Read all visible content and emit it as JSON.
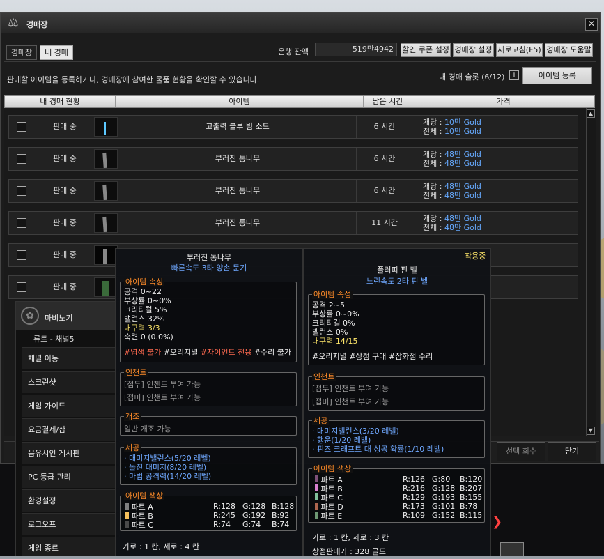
{
  "window": {
    "title": "경매장",
    "close": "✕"
  },
  "tabs": [
    {
      "label": "경매장",
      "active": false
    },
    {
      "label": "내 경매",
      "active": true
    }
  ],
  "bank": {
    "label": "은행 잔액",
    "value": "519만4942"
  },
  "header_buttons": [
    "할인 쿠폰 설정",
    "경매장 설정",
    "새로고침(F5)",
    "경매장 도움말"
  ],
  "info_text": "판매할 아이템을 등록하거나, 경매장에 참여한 물품 현황을 확인할 수 있습니다.",
  "slots": {
    "label": "내 경매 슬롯 (6/12)",
    "plus": "+",
    "register": "아이템 등록"
  },
  "columns": [
    "내 경매 현황",
    "아이템",
    "남은 시간",
    "가격"
  ],
  "rows": [
    {
      "status": "판매 중",
      "item": "고출력 블루 빔 소드",
      "time": "6 시간",
      "unit_label": "개당 : ",
      "unit": "10만 Gold",
      "total_label": "전체 : ",
      "total": "10만 Gold"
    },
    {
      "status": "판매 중",
      "item": "부러진 통나무",
      "time": "6 시간",
      "unit_label": "개당 : ",
      "unit": "48만 Gold",
      "total_label": "전체 : ",
      "total": "48만 Gold"
    },
    {
      "status": "판매 중",
      "item": "부러진 통나무",
      "time": "6 시간",
      "unit_label": "개당 : ",
      "unit": "48만 Gold",
      "total_label": "전체 : ",
      "total": "48만 Gold"
    },
    {
      "status": "판매 중",
      "item": "부러진 통나무",
      "time": "11 시간",
      "unit_label": "개당 : ",
      "unit": "48만 Gold",
      "total_label": "전체 : ",
      "total": "48만 Gold"
    },
    {
      "status": "판매 중"
    },
    {
      "status": "판매 중"
    }
  ],
  "bottom": {
    "select_count": "선택 회수",
    "close": "닫기"
  },
  "menu": {
    "logo": "마비노기",
    "channel": "류트 - 채널5",
    "items": [
      "채널 이동",
      "스크린샷",
      "게임 가이드",
      "요금결제/샵",
      "음유시인 게시판",
      "PC 등급 관리",
      "환경설정",
      "로그오프",
      "게임 종료"
    ]
  },
  "tooltip_left": {
    "name": "부러진 통나무",
    "sub": "빠른속도 3타 양손 둔기",
    "attr_title": "아이템 속성",
    "attrs": [
      "공격 0~22",
      "부상률 0~0%",
      "크리티컬 5%",
      "밸런스 32%"
    ],
    "durability": "내구력 3/3",
    "proficiency": "숙련 0 (0.0%)",
    "tags": [
      "#염색 불가",
      "#오리지널",
      "#자이언트 전용",
      "#수리 불가"
    ],
    "enchant_title": "인챈트",
    "enchant": [
      "[접두] 인챈트 부여 가능",
      "[접미] 인챈트 부여 가능"
    ],
    "reform_title": "개조",
    "reform": "일반 개조 가능",
    "craft_title": "세공",
    "craft": [
      "· 대미지밸런스(5/20 레벨)",
      "· 돌진 대미지(8/20 레벨)",
      "· 마법 공격력(14/20 레벨)"
    ],
    "color_title": "아이템 색상",
    "colors": [
      {
        "name": "파트 A",
        "r": "R:128",
        "g": "G:128",
        "b": "B:128",
        "hex": "#808080"
      },
      {
        "name": "파트 B",
        "r": "R:245",
        "g": "G:192",
        "b": "B:92",
        "hex": "#f5c05c"
      },
      {
        "name": "파트 C",
        "r": "R:74",
        "g": "G:74",
        "b": "B:74",
        "hex": "#4a4a4a"
      }
    ],
    "size": "가로 : 1 칸, 세로 : 4 칸"
  },
  "tooltip_right": {
    "equipped": "착용중",
    "name": "플러피 핀 벨",
    "sub": "느린속도 2타 핀 벨",
    "attr_title": "아이템 속성",
    "attrs": [
      "공격 2~5",
      "부상률 0~0%",
      "크리티컬 0%",
      "밸런스 0%"
    ],
    "durability": "내구력 14/15",
    "tags": [
      "#오리지널",
      "#상점 구매",
      "#잡화점 수리"
    ],
    "enchant_title": "인챈트",
    "enchant": [
      "[접두] 인챈트 부여 가능",
      "[접미] 인챈트 부여 가능"
    ],
    "craft_title": "세공",
    "craft": [
      "· 대미지밸런스(3/20 레벨)",
      "· 행운(1/20 레벨)",
      "· 핀즈 크래프트 대 성공 확률(1/10 레벨)"
    ],
    "color_title": "아이템 색상",
    "colors": [
      {
        "name": "파트 A",
        "r": "R:126",
        "g": "G:80",
        "b": "B:120",
        "hex": "#7e5078"
      },
      {
        "name": "파트 B",
        "r": "R:216",
        "g": "G:128",
        "b": "B:207",
        "hex": "#d880cf"
      },
      {
        "name": "파트 C",
        "r": "R:129",
        "g": "G:193",
        "b": "B:155",
        "hex": "#81c19b"
      },
      {
        "name": "파트 D",
        "r": "R:173",
        "g": "G:101",
        "b": "B:78",
        "hex": "#ad654e"
      },
      {
        "name": "파트 E",
        "r": "R:109",
        "g": "G:152",
        "b": "B:115",
        "hex": "#6d9873"
      }
    ],
    "size": "가로 : 1 칸, 세로 : 3 칸",
    "shop_price": "상점판매가 : 328 골드"
  }
}
